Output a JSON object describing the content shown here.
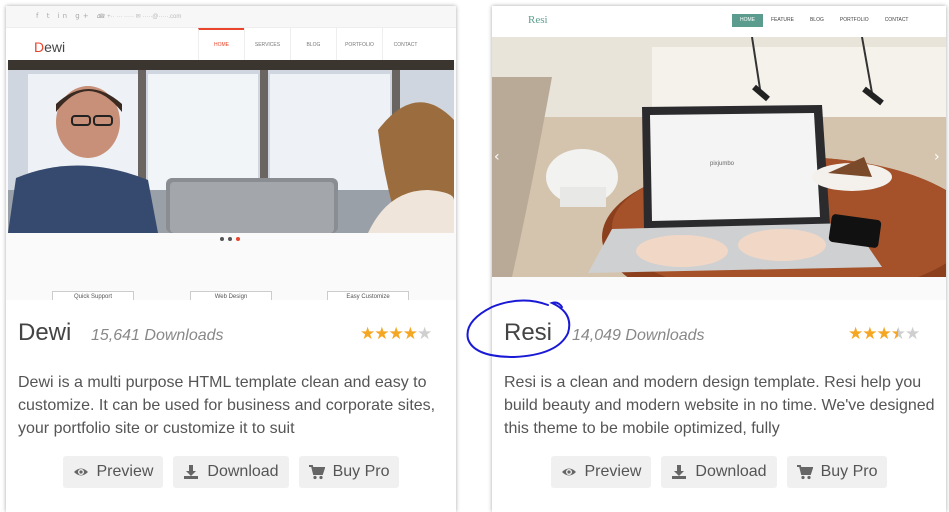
{
  "templates": [
    {
      "id": "dewi",
      "thumbnail": {
        "logo": "Dewi",
        "nav": [
          "HOME",
          "SERVICES",
          "BLOG",
          "PORTFOLIO",
          "CONTACT"
        ],
        "features": [
          "Quick Support",
          "Web Design",
          "Easy Customize"
        ]
      },
      "title": "Dewi",
      "downloads": "15,641 Downloads",
      "rating": 4,
      "description": "Dewi is a multi purpose HTML template clean and easy to customize. It can be used for business and corporate sites, your portfolio site or customize it to suit",
      "buttons": {
        "preview": "Preview",
        "download": "Download",
        "buy": "Buy Pro"
      }
    },
    {
      "id": "resi",
      "thumbnail": {
        "logo": "Resi",
        "nav": [
          "HOME",
          "FEATURE",
          "BLOG",
          "PORTFOLIO",
          "CONTACT"
        ]
      },
      "title": "Resi",
      "downloads": "14,049 Downloads",
      "rating": 3.5,
      "description": "Resi is a clean and modern design template. Resi help you build beauty and modern website in no time. We've designed this theme to be mobile optimized, fully",
      "buttons": {
        "preview": "Preview",
        "download": "Download",
        "buy": "Buy Pro"
      }
    }
  ],
  "icons": {
    "preview": "eye-icon",
    "download": "download-icon",
    "buy": "cart-icon",
    "rating": "star-icon"
  },
  "colors": {
    "star": "#f5a623",
    "dewi_accent": "#e8452c",
    "resi_accent": "#5c9c8e",
    "annotation": "#1a1ad6"
  }
}
